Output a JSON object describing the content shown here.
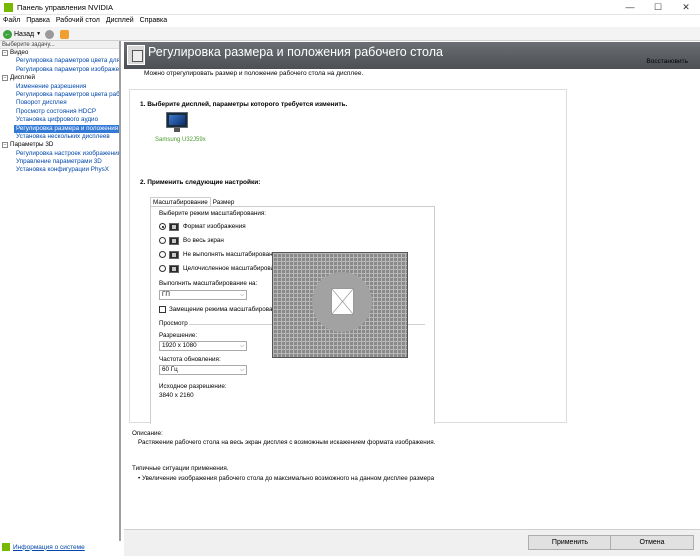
{
  "window": {
    "title": "Панель управления NVIDIA",
    "minimize": "—",
    "maximize": "☐",
    "close": "✕"
  },
  "menu": [
    "Файл",
    "Правка",
    "Рабочий стол",
    "Дисплей",
    "Справка"
  ],
  "toolbar": {
    "back_label": "Назад"
  },
  "sidebar": {
    "task_header": "Выберите задачу...",
    "categories": [
      {
        "label": "Видео",
        "items": [
          "Регулировка параметров цвета для вид",
          "Регулировка параметров изображения д"
        ]
      },
      {
        "label": "Дисплей",
        "items": [
          "Изменение разрешения",
          "Регулировка параметров цвета рабочег",
          "Поворот дисплея",
          "Просмотр состояния HDCP",
          "Установка цифрового аудио",
          "Регулировка размера и положения рабоч",
          "Установка нескольких дисплеев"
        ]
      },
      {
        "label": "Параметры 3D",
        "items": [
          "Регулировка настроек изображения с п",
          "Управление параметрами 3D",
          "Установка конфигурации PhysX"
        ]
      }
    ],
    "system_info": "Информация о системе"
  },
  "header": {
    "title": "Регулировка размера и положения рабочего стола"
  },
  "page": {
    "description": "Можно отрегулировать размер и положение рабочего стола на дисплее.",
    "restore": "Восстановить",
    "step1": "1. Выберите дисплей, параметры которого требуется изменить.",
    "display_name": "Samsung U32J59x",
    "step2": "2. Применить следующие настройки:",
    "tabs": [
      "Масштабирование",
      "Размер"
    ],
    "scaling_mode_label": "Выберите режим масштабирования:",
    "scaling_modes": [
      "Формат изображения",
      "Во весь экран",
      "Не выполнять масштабирование",
      "Целочисленное масштабирование"
    ],
    "perform_on_label": "Выполнить масштабирование на:",
    "perform_on_value": "ГП",
    "override_label": "Замещение режима масштабирования, заданного для игр и программ",
    "preview_label": "Просмотр",
    "resolution_label": "Разрешение:",
    "resolution_value": "1920 x 1080",
    "refresh_label": "Частота обновления:",
    "refresh_value": "60 Гц",
    "source_res_label": "Исходное разрешение:",
    "source_res_value": "3840 x 2160",
    "desc_heading": "Описание:",
    "desc_text": "Растяжение рабочего стола на весь экран дисплея с возможным искажением формата изображения.",
    "typical_heading": "Типичные ситуации применения.",
    "typical_item": "Увеличение изображения рабочего стола до максимально возможного на данном дисплее размера"
  },
  "footer": {
    "apply": "Применить",
    "cancel": "Отмена"
  },
  "colors": {
    "accent": "#76b900",
    "header_bg": "#5c6064",
    "selection": "#3379d6",
    "link": "#0047ab"
  }
}
